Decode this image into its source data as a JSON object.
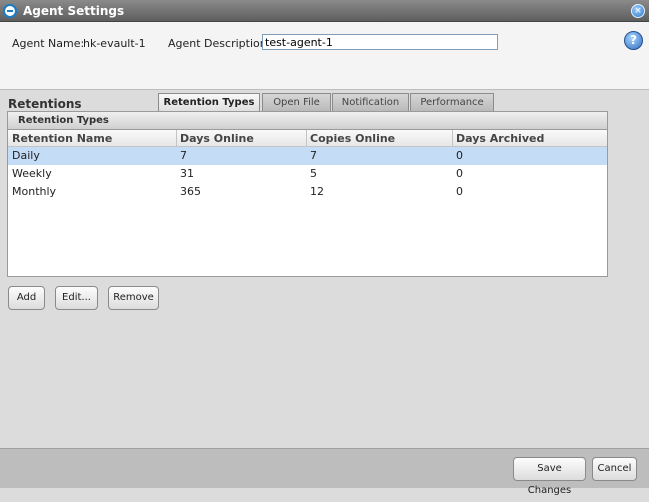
{
  "window": {
    "title": "Agent Settings",
    "close_icon": "close-icon",
    "help_icon": "?"
  },
  "header": {
    "agent_name_label": "Agent Name:",
    "agent_name_value": "hk-evault-1",
    "agent_description_label": "Agent Description:",
    "agent_description_value": "test-agent-1"
  },
  "tabs": [
    {
      "label": "Retention Types",
      "active": true
    },
    {
      "label": "Open File",
      "active": false
    },
    {
      "label": "Notification",
      "active": false
    },
    {
      "label": "Performance",
      "active": false
    }
  ],
  "retentions": {
    "section_label": "Retentions",
    "panel_title": "Retention Types",
    "columns": [
      "Retention Name",
      "Days Online",
      "Copies Online",
      "Days Archived"
    ],
    "rows": [
      {
        "name": "Daily",
        "days_online": "7",
        "copies_online": "7",
        "days_archived": "0",
        "selected": true
      },
      {
        "name": "Weekly",
        "days_online": "31",
        "copies_online": "5",
        "days_archived": "0",
        "selected": false
      },
      {
        "name": "Monthly",
        "days_online": "365",
        "copies_online": "12",
        "days_archived": "0",
        "selected": false
      }
    ]
  },
  "actions": {
    "add_label": "Add",
    "edit_label": "Edit...",
    "remove_label": "Remove"
  },
  "footer": {
    "save_label": "Save Changes",
    "cancel_label": "Cancel"
  },
  "colors": {
    "selection": "#c4dcf6",
    "accent": "#1a7cc7",
    "titlebar": "#6e6e6e"
  }
}
